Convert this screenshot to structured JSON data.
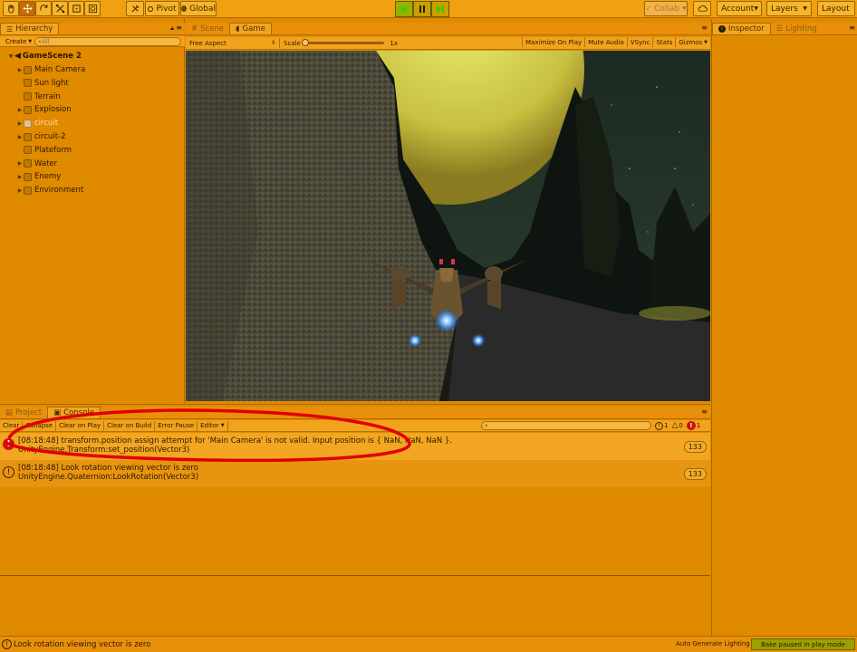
{
  "toolbar": {
    "pivot_label": "Pivot",
    "global_label": "Global",
    "collab_label": "Collab",
    "account_label": "Account",
    "layers_label": "Layers",
    "layout_label": "Layout"
  },
  "hierarchy": {
    "tab_label": "Hierarchy",
    "create_label": "Create",
    "search_placeholder": "All",
    "scene_name": "GameScene 2",
    "items": [
      {
        "label": "Main Camera",
        "expandable": true,
        "disabled": false
      },
      {
        "label": "Sun light",
        "expandable": false,
        "disabled": false
      },
      {
        "label": "Terrain",
        "expandable": false,
        "disabled": false
      },
      {
        "label": "Explosion",
        "expandable": true,
        "disabled": false
      },
      {
        "label": "circuit",
        "expandable": true,
        "disabled": true
      },
      {
        "label": "circuit-2",
        "expandable": true,
        "disabled": false
      },
      {
        "label": "Plateform",
        "expandable": false,
        "disabled": false
      },
      {
        "label": "Water",
        "expandable": true,
        "disabled": false
      },
      {
        "label": "Enemy",
        "expandable": true,
        "disabled": false
      },
      {
        "label": "Environment",
        "expandable": true,
        "disabled": false
      }
    ]
  },
  "view_tabs": {
    "scene_label": "Scene",
    "game_label": "Game"
  },
  "game_bar": {
    "aspect_label": "Free Aspect",
    "scale_label": "Scale",
    "scale_value": "1x",
    "maximize_label": "Maximize On Play",
    "mute_label": "Mute Audio",
    "vsync_label": "VSync",
    "stats_label": "Stats",
    "gizmos_label": "Gizmos"
  },
  "right_tabs": {
    "inspector_label": "Inspector",
    "lighting_label": "Lighting"
  },
  "bottom_tabs": {
    "project_label": "Project",
    "console_label": "Console"
  },
  "console_bar": {
    "clear_label": "Clear",
    "collapse_label": "Collapse",
    "clear_on_play_label": "Clear on Play",
    "clear_on_build_label": "Clear on Build",
    "error_pause_label": "Error Pause",
    "editor_label": "Editor",
    "info_count": "1",
    "warn_count": "0",
    "error_count": "1"
  },
  "console_logs": [
    {
      "type": "error",
      "line1": "[08:18:48] transform.position assign attempt for 'Main Camera' is not valid. Input position is { NaN, NaN, NaN }.",
      "line2": "UnityEngine.Transform:set_position(Vector3)",
      "count": "133"
    },
    {
      "type": "warning",
      "line1": "[08:18:48] Look rotation viewing vector is zero",
      "line2": "UnityEngine.Quaternion:LookRotation(Vector3)",
      "count": "133"
    }
  ],
  "status_bar": {
    "message": "Look rotation viewing vector is zero",
    "auto_generate": "Auto Generate Lighting On",
    "bake_status": "Bake paused in play mode"
  },
  "colors": {
    "accent": "#e08a00",
    "error": "#d01010",
    "highlight_ellipse": "#e00000"
  }
}
